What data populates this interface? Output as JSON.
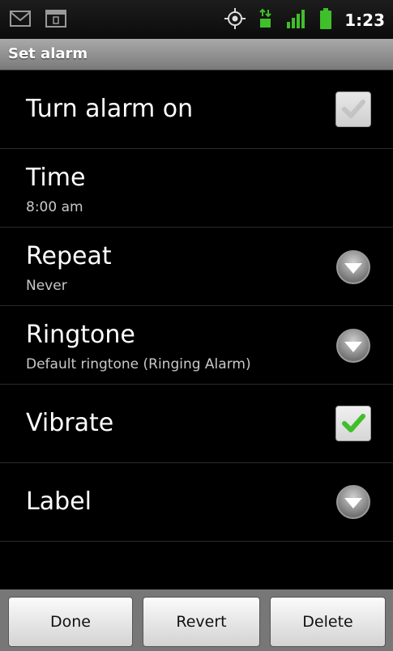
{
  "status_bar": {
    "time": "1:23",
    "icons": [
      "gmail-icon",
      "notification-icon",
      "gps-icon",
      "3g-data-icon",
      "signal-icon",
      "battery-icon"
    ]
  },
  "title_bar": {
    "title": "Set alarm"
  },
  "settings": {
    "alarm_on": {
      "label": "Turn alarm on",
      "checked": false
    },
    "time": {
      "label": "Time",
      "value": "8:00 am"
    },
    "repeat": {
      "label": "Repeat",
      "value": "Never"
    },
    "ringtone": {
      "label": "Ringtone",
      "value": "Default ringtone (Ringing Alarm)"
    },
    "vibrate": {
      "label": "Vibrate",
      "checked": true
    },
    "label": {
      "label": "Label"
    }
  },
  "buttons": {
    "done": "Done",
    "revert": "Revert",
    "delete": "Delete"
  },
  "colors": {
    "check": "#3fbf2a",
    "background": "#000000",
    "title_bar": "#8a8a8a"
  }
}
